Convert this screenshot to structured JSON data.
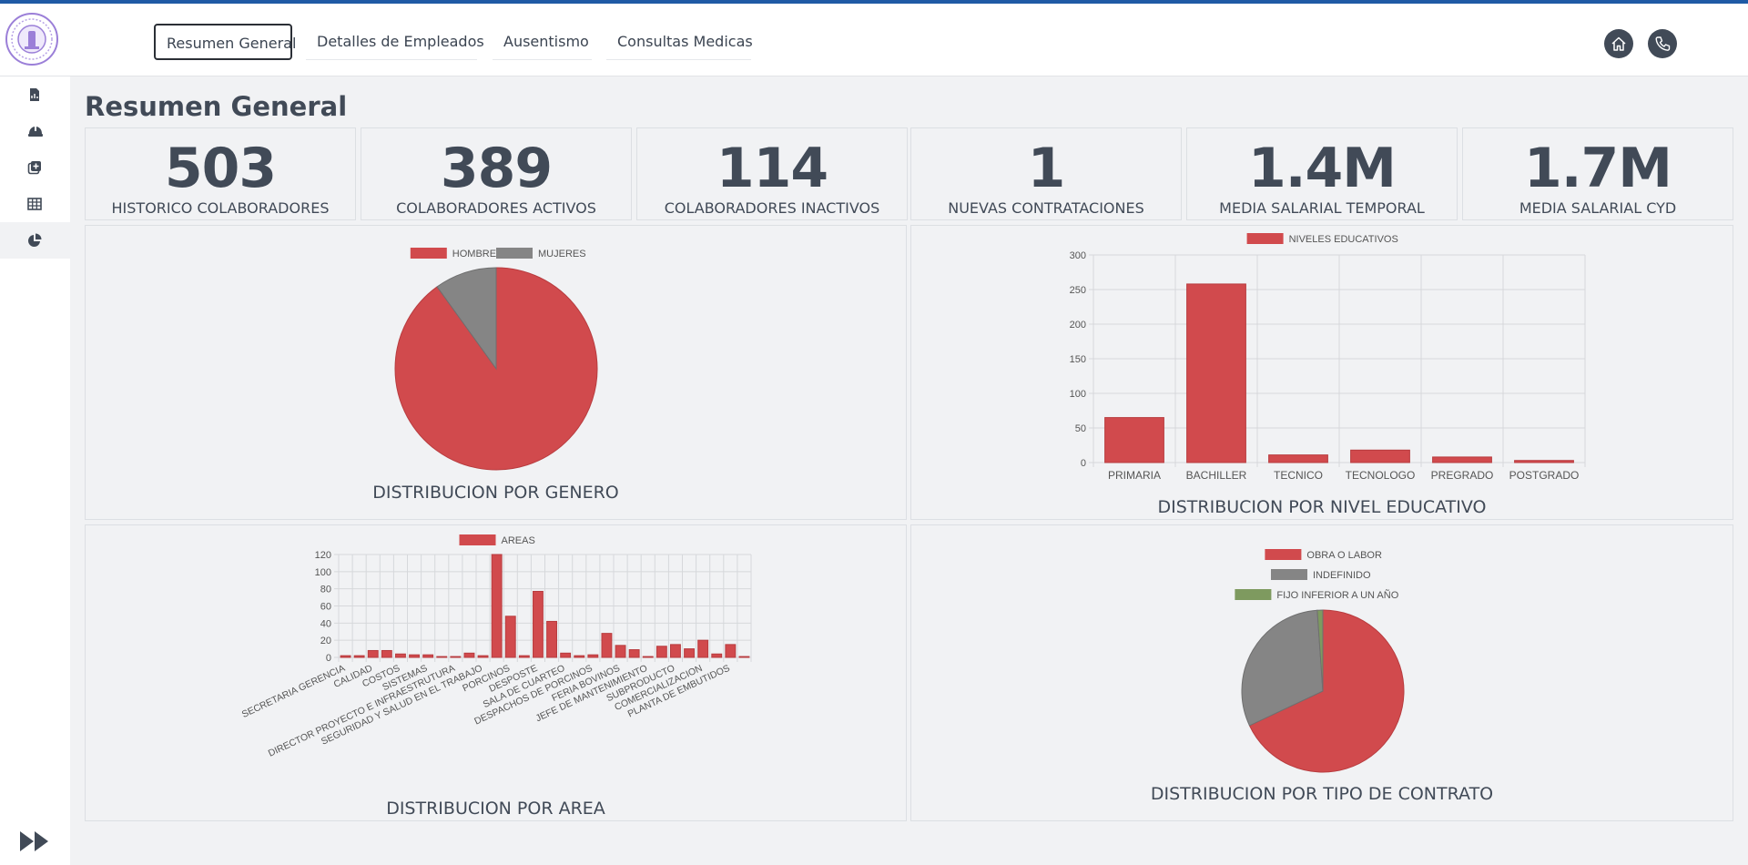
{
  "header": {
    "tabs": [
      {
        "label": "Resumen General",
        "active": true
      },
      {
        "label": "Detalles de Empleados",
        "active": false
      },
      {
        "label": "Ausentismo",
        "active": false
      },
      {
        "label": "Consultas Medicas",
        "active": false
      }
    ],
    "icons": [
      "home-icon",
      "phone-icon"
    ]
  },
  "sidebar": {
    "items": [
      {
        "icon": "file-chart-icon"
      },
      {
        "icon": "hard-hat-icon"
      },
      {
        "icon": "medical-plus-icon"
      },
      {
        "icon": "table-icon"
      },
      {
        "icon": "pie-chart-icon",
        "active": true
      }
    ],
    "footer_icon": "fast-forward-icon"
  },
  "page": {
    "title": "Resumen General"
  },
  "kpis": [
    {
      "value": "503",
      "label": "HISTORICO COLABORADORES"
    },
    {
      "value": "389",
      "label": "COLABORADORES ACTIVOS"
    },
    {
      "value": "114",
      "label": "COLABORADORES INACTIVOS"
    },
    {
      "value": "1",
      "label": "NUEVAS CONTRATACIONES"
    },
    {
      "value": "1.4M",
      "label": "MEDIA SALARIAL TEMPORAL"
    },
    {
      "value": "1.7M",
      "label": "MEDIA SALARIAL CYD"
    }
  ],
  "colors": {
    "red": "#d14a4d",
    "gray": "#858585",
    "green": "#7e9a5f",
    "text": "#414a57",
    "accent": "#1f5aa5"
  },
  "chart_data": [
    {
      "type": "pie",
      "title": "DISTRIBUCION POR GENERO",
      "legend_position": "top",
      "series": [
        {
          "name": "HOMBRES",
          "value": 453,
          "color": "#d14a4d"
        },
        {
          "name": "MUJERES",
          "value": 50,
          "color": "#858585"
        }
      ]
    },
    {
      "type": "bar",
      "title": "DISTRIBUCION POR NIVEL EDUCATIVO",
      "legend_position": "top",
      "series_name": "NIVELES EDUCATIVOS",
      "categories": [
        "PRIMARIA",
        "BACHILLER",
        "TECNICO",
        "TECNOLOGO",
        "PREGRADO",
        "POSTGRADO"
      ],
      "values": [
        65,
        258,
        11,
        18,
        8,
        3
      ],
      "ylim": [
        0,
        300
      ],
      "yticks": [
        0,
        50,
        100,
        150,
        200,
        250,
        300
      ],
      "grid": true
    },
    {
      "type": "bar",
      "title": "DISTRIBUCION POR AREA",
      "legend_position": "top",
      "series_name": "AREAS",
      "categories": [
        "SECRETARIA GERENCIA",
        "",
        "CALIDAD",
        "",
        "COSTOS",
        "",
        "SISTEMAS",
        "",
        "DIRECTOR PROYECTO E INFRAESTRUTURA",
        "",
        "SEGURIDAD Y SALUD EN EL TRABAJO",
        "",
        "PORCINOS",
        "",
        "DESPOSTE",
        "",
        "SALA DE CUARTEO",
        "",
        "DESPACHOS DE PORCINOS",
        "",
        "FERIA BOVINOS",
        "",
        "JEFE DE MANTENIMIENTO",
        "",
        "SUBPRODUCTO",
        "",
        "COMERCIALIZACION",
        "",
        "PLANTA DE EMBUTIDOS",
        ""
      ],
      "values": [
        2,
        2,
        8,
        8,
        4,
        3,
        3,
        1,
        1,
        5,
        2,
        120,
        48,
        2,
        77,
        42,
        5,
        2,
        3,
        28,
        14,
        9,
        1,
        13,
        15,
        10,
        20,
        4,
        15,
        1
      ],
      "ylim": [
        0,
        120
      ],
      "yticks": [
        0,
        20,
        40,
        60,
        80,
        100,
        120
      ],
      "grid": true
    },
    {
      "type": "pie",
      "title": "DISTRIBUCION POR TIPO DE CONTRATO",
      "legend_position": "top",
      "series": [
        {
          "name": "OBRA O LABOR",
          "value": 68,
          "color": "#d14a4d"
        },
        {
          "name": "INDEFINIDO",
          "value": 30.9,
          "color": "#858585"
        },
        {
          "name": "FIJO INFERIOR A UN AÑO",
          "value": 1.1,
          "color": "#7e9a5f"
        }
      ]
    }
  ]
}
